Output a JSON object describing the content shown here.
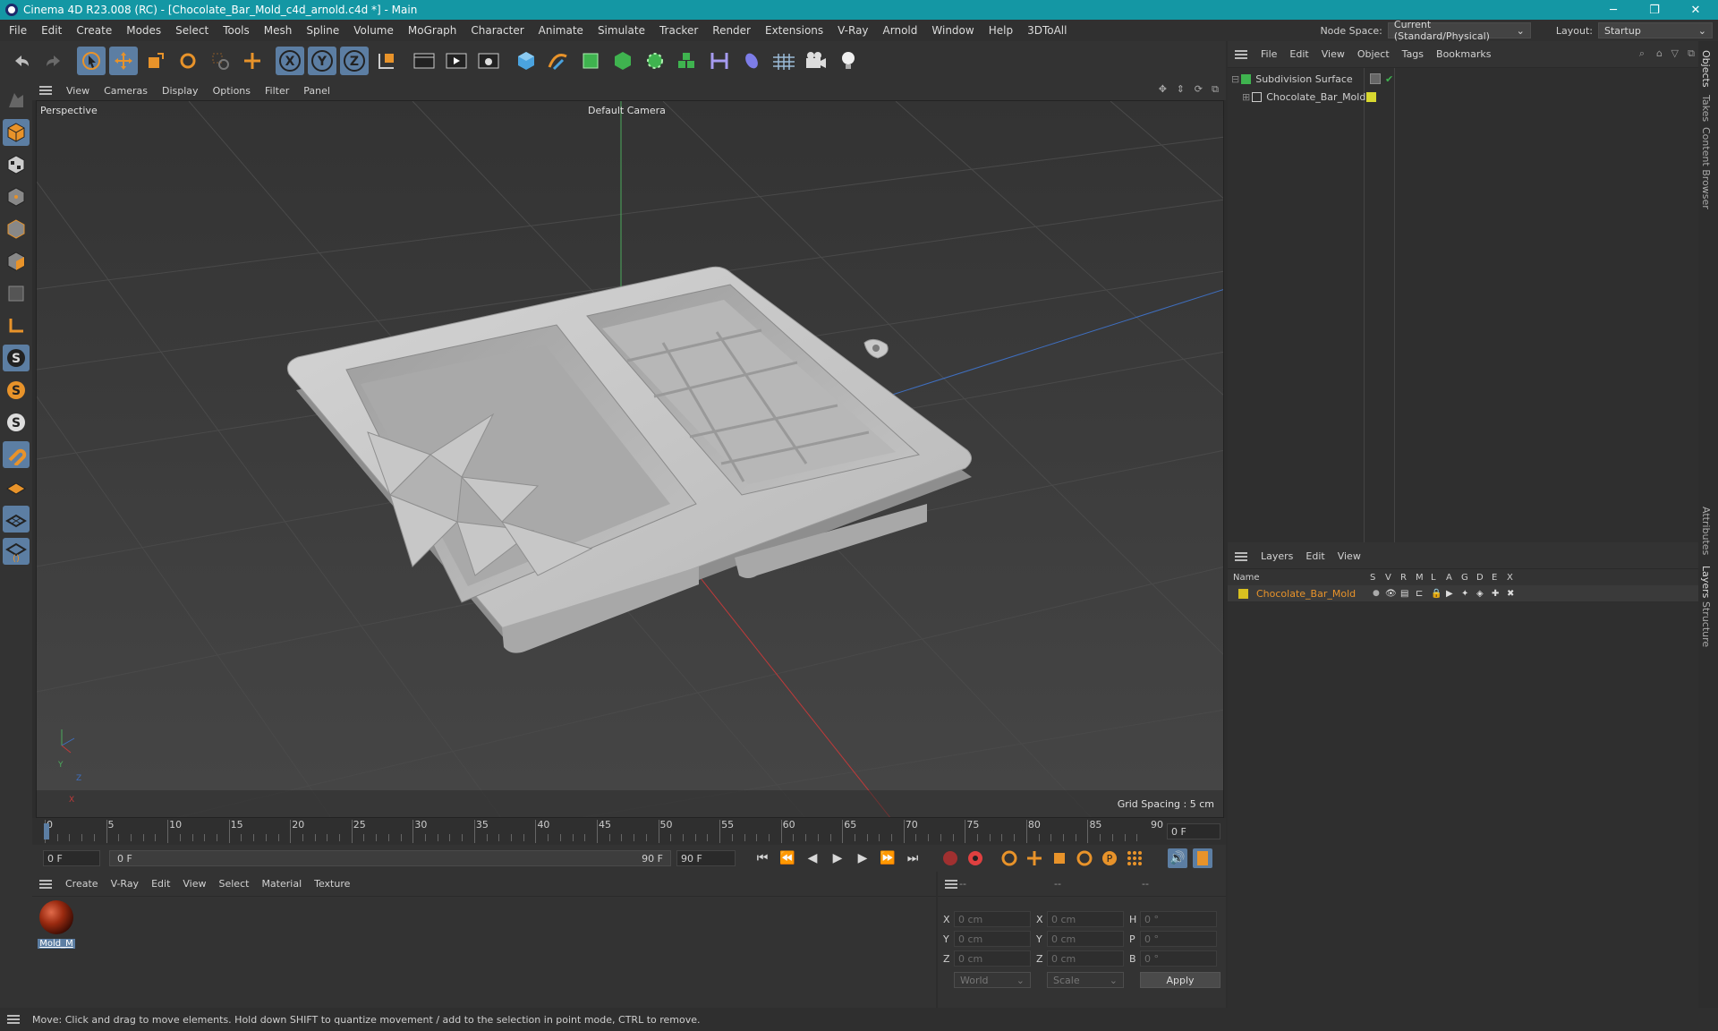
{
  "titlebar": {
    "title": "Cinema 4D R23.008 (RC) - [Chocolate_Bar_Mold_c4d_arnold.c4d *] - Main",
    "minimize": "─",
    "restore": "❐",
    "close": "✕"
  },
  "menubar": {
    "items": [
      "File",
      "Edit",
      "Create",
      "Modes",
      "Select",
      "Tools",
      "Mesh",
      "Spline",
      "Volume",
      "MoGraph",
      "Character",
      "Animate",
      "Simulate",
      "Tracker",
      "Render",
      "Extensions",
      "V-Ray",
      "Arnold",
      "Window",
      "Help",
      "3DToAll"
    ],
    "node_space_label": "Node Space:",
    "node_space_value": "Current (Standard/Physical)",
    "layout_label": "Layout:",
    "layout_value": "Startup"
  },
  "viewport": {
    "menu": [
      "View",
      "Cameras",
      "Display",
      "Options",
      "Filter",
      "Panel"
    ],
    "view_name": "Perspective",
    "camera": "Default Camera",
    "grid_spacing": "Grid Spacing : 5 cm",
    "axis_y": "Y",
    "axis_z": "Z",
    "axis_x": "X"
  },
  "timeline": {
    "ticks": [
      "0",
      "5",
      "10",
      "15",
      "20",
      "25",
      "30",
      "35",
      "40",
      "45",
      "50",
      "55",
      "60",
      "65",
      "70",
      "75",
      "80",
      "85",
      "90"
    ],
    "current_frame_field": "0 F",
    "start_field": "0 F",
    "range_start": "0 F",
    "range_end": "90 F",
    "end_field": "90 F"
  },
  "material_panel": {
    "menu": [
      "Create",
      "V-Ray",
      "Edit",
      "View",
      "Select",
      "Material",
      "Texture"
    ],
    "materials": [
      {
        "name": "Mold_M",
        "color": "#9a2a10"
      }
    ]
  },
  "coord_panel": {
    "headers": [
      "--",
      "--",
      "--"
    ],
    "rows": [
      {
        "a_label": "X",
        "a_val": "0 cm",
        "b_label": "X",
        "b_val": "0 cm",
        "c_label": "H",
        "c_val": "0 °"
      },
      {
        "a_label": "Y",
        "a_val": "0 cm",
        "b_label": "Y",
        "b_val": "0 cm",
        "c_label": "P",
        "c_val": "0 °"
      },
      {
        "a_label": "Z",
        "a_val": "0 cm",
        "b_label": "Z",
        "b_val": "0 cm",
        "c_label": "B",
        "c_val": "0 °"
      }
    ],
    "space": "World",
    "mode": "Scale",
    "apply": "Apply"
  },
  "objects_panel": {
    "menu": [
      "File",
      "Edit",
      "View",
      "Object",
      "Tags",
      "Bookmarks"
    ],
    "items": [
      {
        "name": "Subdivision Surface",
        "color": "#3fb34f"
      },
      {
        "name": "Chocolate_Bar_Mold",
        "color": "#d8d830"
      }
    ]
  },
  "layers_panel": {
    "menu": [
      "Layers",
      "Edit",
      "View"
    ],
    "columns": [
      "Name",
      "S",
      "V",
      "R",
      "M",
      "L",
      "A",
      "G",
      "D",
      "E",
      "X"
    ],
    "layers": [
      {
        "name": "Chocolate_Bar_Mold",
        "color": "#d8c020"
      }
    ]
  },
  "side_tabs": [
    "Objects",
    "Takes",
    "Content Browser",
    "Attributes",
    "Layers",
    "Structure"
  ],
  "status": "Move: Click and drag to move elements. Hold down SHIFT to quantize movement / add to the selection in point mode, CTRL to remove.",
  "colors": {
    "titlebar": "#1497a4",
    "selection": "#5c7ea3",
    "accent_orange": "#e8932a"
  }
}
